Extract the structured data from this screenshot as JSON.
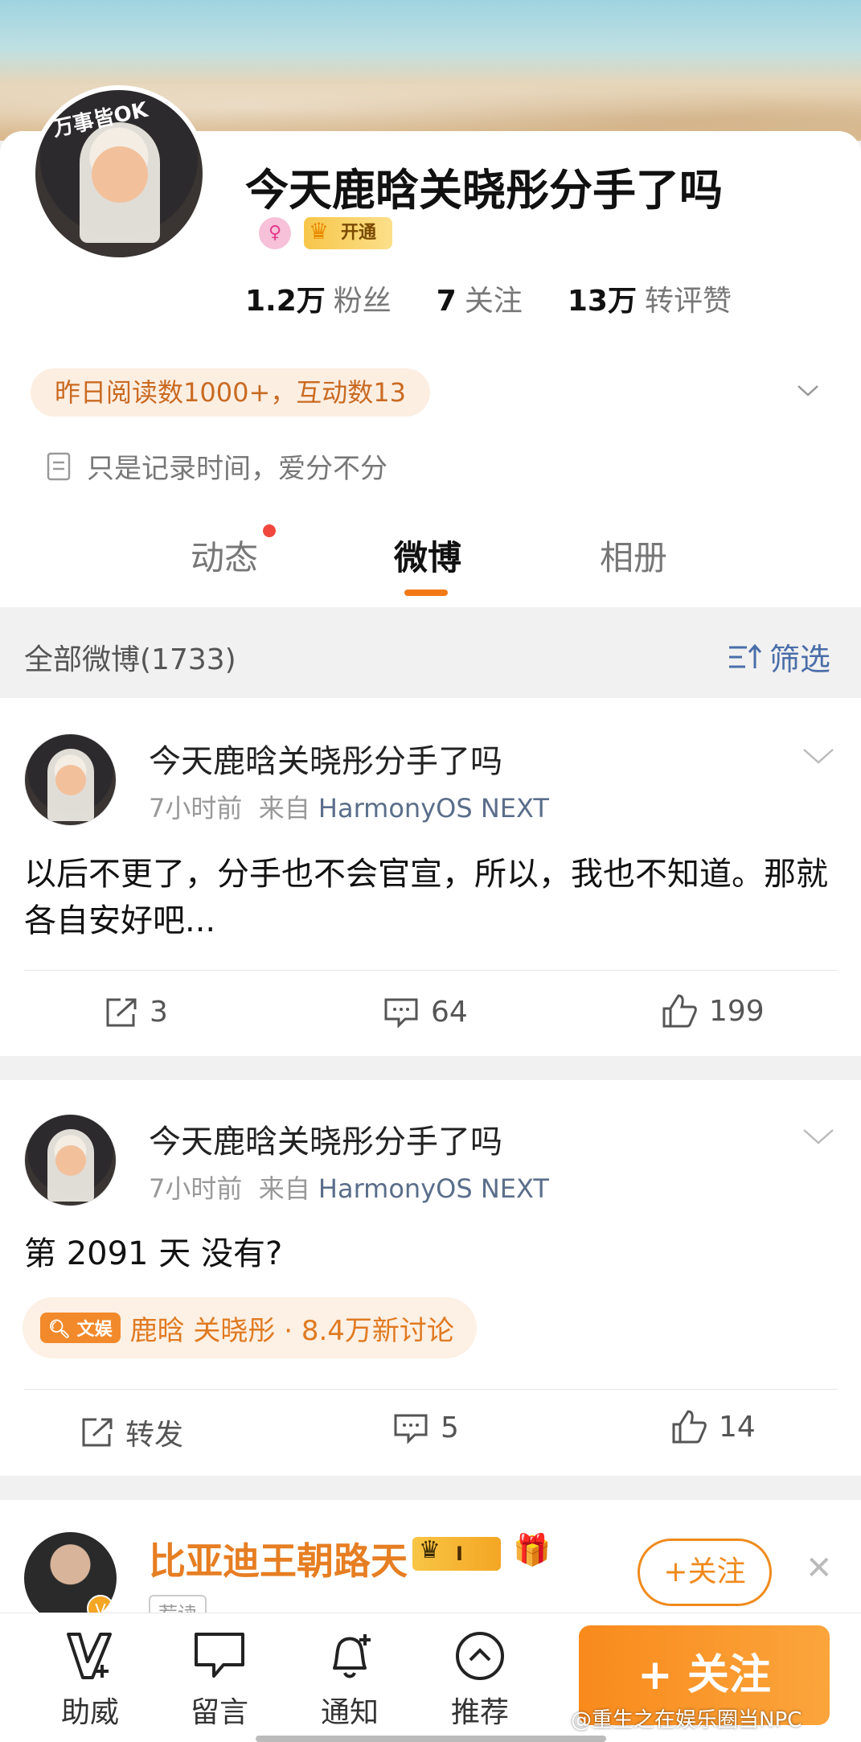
{
  "profile": {
    "username": "今天鹿晗关晓彤分手了吗",
    "avatar_caption": "万事皆OK",
    "vip_label": "开通",
    "stats": [
      {
        "value": "1.2万",
        "label": "粉丝"
      },
      {
        "value": "7",
        "label": "关注"
      },
      {
        "value": "13万",
        "label": "转评赞"
      }
    ],
    "read_stats": "昨日阅读数1000+，互动数13",
    "bio": "只是记录时间，爱分不分"
  },
  "tabs": [
    {
      "label": "动态",
      "has_dot": true
    },
    {
      "label": "微博",
      "active": true
    },
    {
      "label": "相册"
    }
  ],
  "filter": {
    "title": "全部微博(1733)",
    "button": "筛选"
  },
  "posts": [
    {
      "author": "今天鹿晗关晓彤分手了吗",
      "time": "7小时前",
      "source_prefix": "来自",
      "source": "HarmonyOS NEXT",
      "text": "以后不更了，分手也不会官宣，所以，我也不知道。那就各自安好吧...",
      "repost": "3",
      "comments": "64",
      "likes": "199"
    },
    {
      "author": "今天鹿晗关晓彤分手了吗",
      "time": "7小时前",
      "source_prefix": "来自",
      "source": "HarmonyOS NEXT",
      "text": "第 2091 天 没有?",
      "topic_tag": "文娱",
      "topic": "鹿晗 关晓彤 · 8.4万新讨论",
      "repost": "转发",
      "comments": "5",
      "likes": "14"
    }
  ],
  "recommend": {
    "name": "比亚迪王朝路天",
    "level": "I",
    "tag": "荐读",
    "follow": "+关注"
  },
  "bottom_bar": {
    "items": [
      "助威",
      "留言",
      "通知",
      "推荐"
    ],
    "follow": "+ 关注"
  },
  "watermark": "@重生之在娱乐圈当NPC",
  "colors": {
    "accent": "#f17a17",
    "link": "#4a6ea9",
    "vip_gold": "#f7c64a"
  }
}
